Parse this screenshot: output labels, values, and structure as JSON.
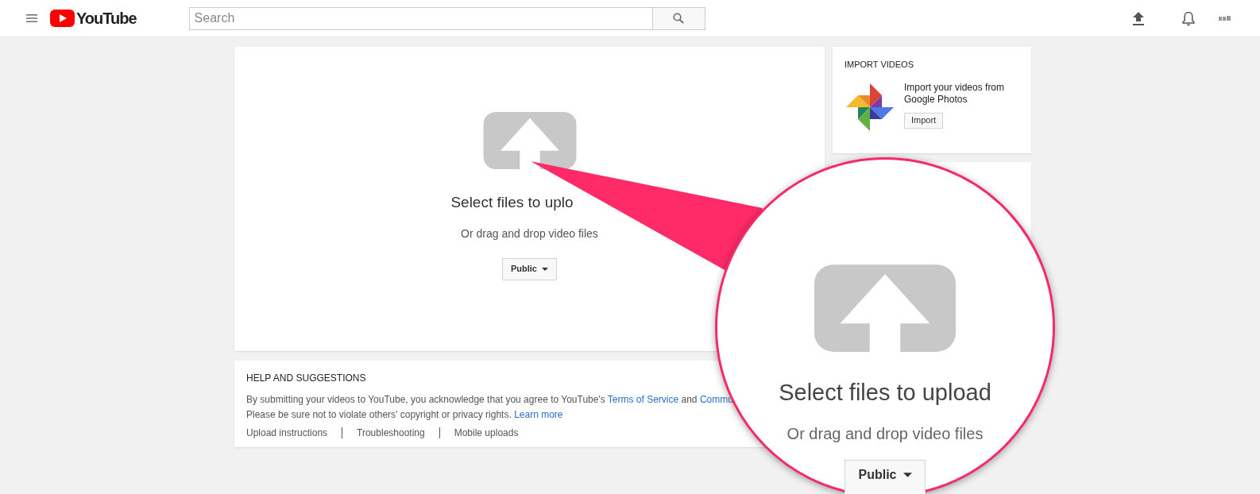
{
  "topbar": {
    "logo_text": "YouTube",
    "search": {
      "placeholder": "Search"
    }
  },
  "upload": {
    "title": "Select files to uplo",
    "subtitle": "Or drag and drop video files",
    "privacy": "Public"
  },
  "import": {
    "heading": "IMPORT VIDEOS",
    "text": "Import your videos from Google Photos",
    "button": "Import"
  },
  "help": {
    "heading": "HELP AND SUGGESTIONS",
    "lines": [
      [
        {
          "kind": "text",
          "text": "By submitting your videos to YouTube, you acknowledge that you agree to YouTube's "
        },
        {
          "kind": "link",
          "text": "Terms of Service"
        },
        {
          "kind": "text",
          "text": " and "
        },
        {
          "kind": "link",
          "text": "Commu"
        }
      ],
      [
        {
          "kind": "text",
          "text": "Please be sure not to violate others' copyright or privacy rights. "
        },
        {
          "kind": "link",
          "text": "Learn more"
        }
      ]
    ],
    "links": [
      "Upload instructions",
      "Troubleshooting",
      "Mobile uploads"
    ]
  },
  "magnifier": {
    "title": "Select files to upload",
    "subtitle": "Or drag and drop video files",
    "privacy": "Public"
  }
}
